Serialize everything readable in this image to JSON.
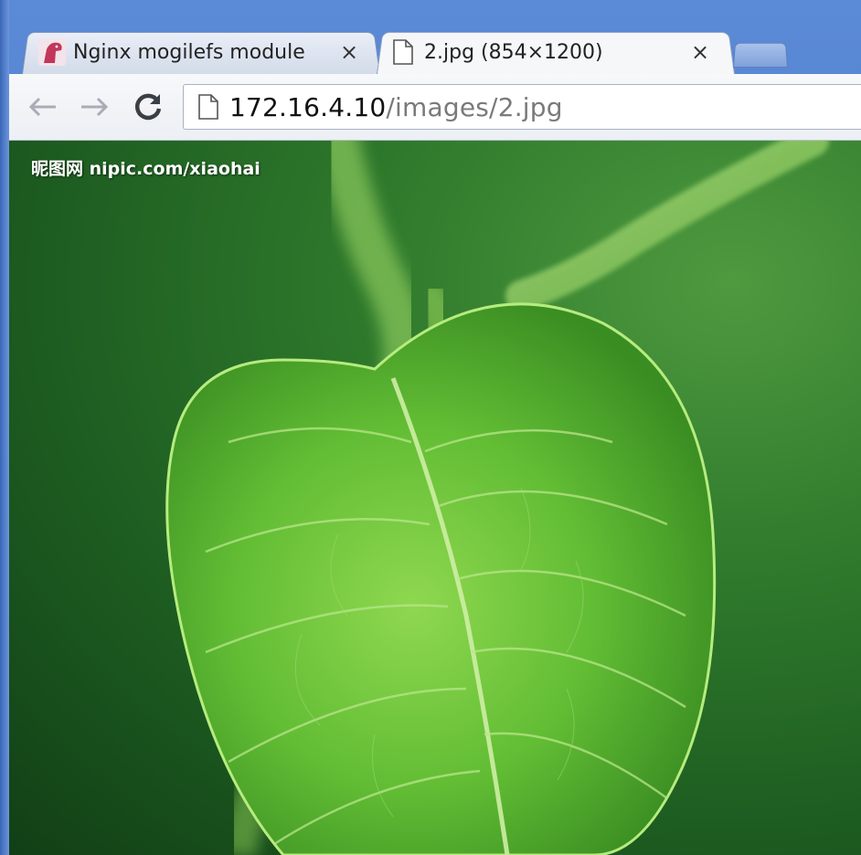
{
  "tabs": [
    {
      "title": "Nginx mogilefs module",
      "favicon": "nginx-favicon-icon",
      "active": false,
      "close": "×"
    },
    {
      "title": "2.jpg (854×1200)",
      "favicon": "page-icon",
      "active": true,
      "close": "×"
    }
  ],
  "toolbar": {
    "back_icon": "back-arrow-icon",
    "forward_icon": "forward-arrow-icon",
    "reload_icon": "reload-icon"
  },
  "omnibox": {
    "url_host": "172.16.4.10",
    "url_path": "/images/2.jpg"
  },
  "image": {
    "subject": "green leaf on stem",
    "watermark": "昵图网 nipic.com/xiaohai"
  },
  "colors": {
    "frame": "#4a78c8",
    "leaf": "#6cc43c",
    "background": "#2f7a2c"
  }
}
